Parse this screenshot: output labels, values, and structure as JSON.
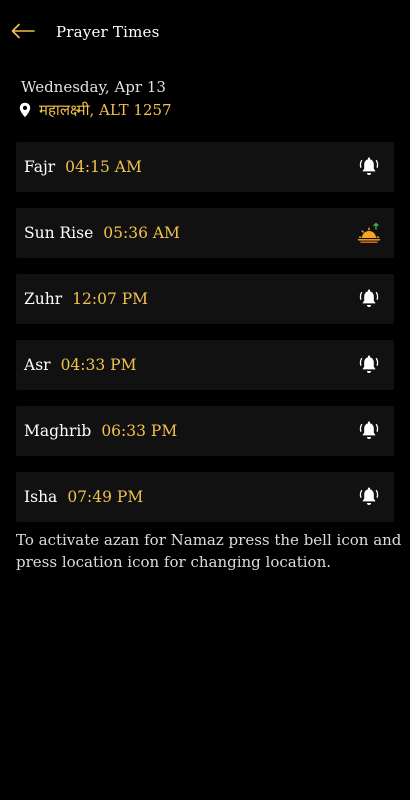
{
  "app_bar": {
    "title": "Prayer Times"
  },
  "date": "Wednesday, Apr 13",
  "location": "महालक्ष्मी, ALT 1257",
  "prayers": [
    {
      "name": "Fajr",
      "time": "04:15 AM",
      "icon": "bell-icon"
    },
    {
      "name": "Sun Rise",
      "time": "05:36 AM",
      "icon": "sunrise-icon"
    },
    {
      "name": "Zuhr",
      "time": "12:07 PM",
      "icon": "bell-icon"
    },
    {
      "name": "Asr",
      "time": "04:33 PM",
      "icon": "bell-icon"
    },
    {
      "name": "Maghrib",
      "time": "06:33 PM",
      "icon": "bell-icon"
    },
    {
      "name": "Isha",
      "time": "07:49 PM",
      "icon": "bell-icon"
    }
  ],
  "info_text": "To activate azan for Namaz press the bell icon and press location icon for changing location.",
  "colors": {
    "background": "#000000",
    "row_background": "#111111",
    "accent": "#f2c14e",
    "text": "#ffffff"
  }
}
